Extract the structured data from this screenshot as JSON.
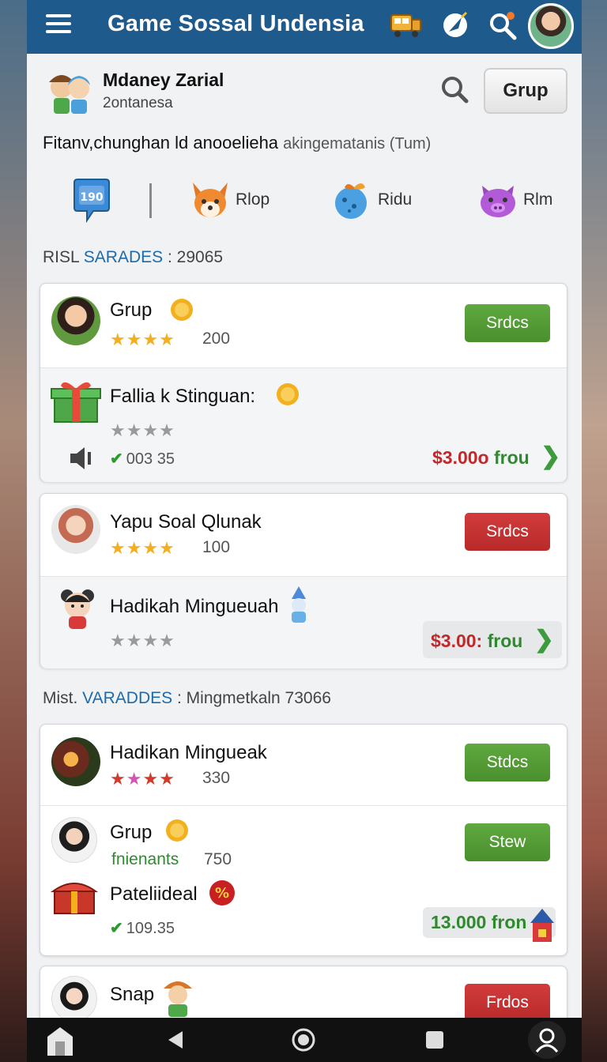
{
  "app": {
    "title": "Game Sosѕal Undensia"
  },
  "header_icons": [
    "truck-icon",
    "rocket-icon",
    "search-magnifier-icon",
    "user-avatar"
  ],
  "profile": {
    "name": "Mdaney Zarial",
    "subtitle": "2ontanesa",
    "grup_button": "Grup"
  },
  "tagline": {
    "main": "Fitanv,chunghan ld anooelieha",
    "muted": "akingematanis (Tum)"
  },
  "categories": [
    {
      "label": "190",
      "icon": "badge-icon"
    },
    {
      "label": "Rlop",
      "icon": "fox-icon"
    },
    {
      "label": "Ridu",
      "icon": "gift-ball-icon"
    },
    {
      "label": "Rlm",
      "icon": "pig-icon"
    }
  ],
  "section1": {
    "prefix": "RISL",
    "highlight": "SARADES",
    "suffix": ": 29065"
  },
  "section2": {
    "prefix": "Mist.",
    "highlight": "VARADDES",
    "suffix": ": Mingmetkaln 73066"
  },
  "card1": {
    "row1": {
      "title": "Grup",
      "count": "200",
      "button": "Srdcs",
      "stars": "★★★★"
    },
    "row2": {
      "title": "Fallia k Stinguan:",
      "stars": "★★★★",
      "check": "003 35",
      "price_amt": "$3.00o",
      "price_fr": "frou"
    }
  },
  "card2": {
    "row1": {
      "title": "Yapu Soal Qlunak",
      "count": "100",
      "button": "Srdcs",
      "stars": "★★★★"
    },
    "row2": {
      "title": "Hadikah Mingueuah",
      "stars": "★★★★",
      "price_amt": "$3.00:",
      "price_fr": "frou"
    }
  },
  "card3": {
    "row1": {
      "title": "Hadikan Mingueak",
      "count": "330",
      "button": "Stdcs"
    },
    "row2": {
      "title": "Grup",
      "subtitle": "fnienants",
      "count": "750",
      "button": "Stew"
    },
    "row3": {
      "title": "Pateliideal",
      "check": "109.35",
      "price": "13.000 fron"
    }
  },
  "card4": {
    "row1": {
      "title": "Snap",
      "button": "Frdos"
    }
  },
  "colors": {
    "appbar": "#1f5a8c",
    "green_button": "#4a8f2e",
    "red_button": "#b82a2a",
    "price_red": "#c0282b",
    "link_blue": "#1f6aa8"
  }
}
